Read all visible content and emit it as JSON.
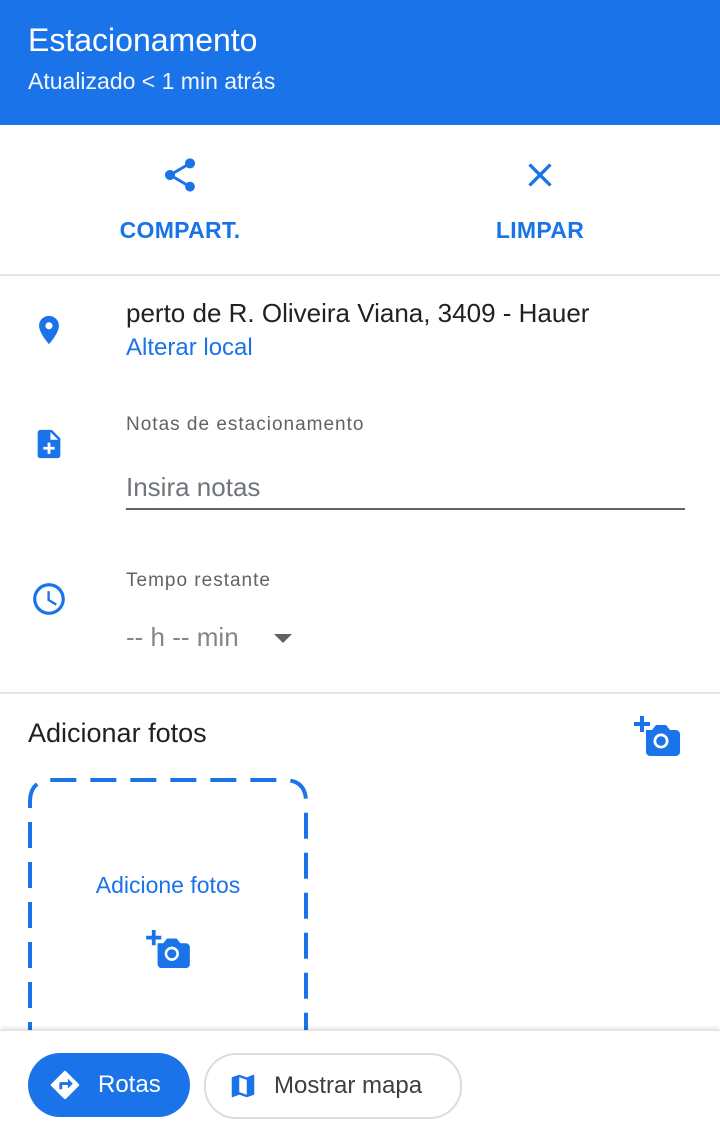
{
  "header": {
    "title": "Estacionamento",
    "subtitle": "Atualizado < 1 min atrás"
  },
  "actions": {
    "share_label": "COMPART.",
    "clear_label": "LIMPAR"
  },
  "location": {
    "address": "perto de R. Oliveira Viana, 3409 - Hauer",
    "change_link": "Alterar local"
  },
  "notes": {
    "label": "Notas de estacionamento",
    "placeholder": "Insira notas",
    "value": ""
  },
  "time": {
    "label": "Tempo restante",
    "value": "-- h -- min"
  },
  "photos": {
    "title": "Adicionar fotos",
    "box_label": "Adicione fotos"
  },
  "bottom_bar": {
    "routes_label": "Rotas",
    "map_label": "Mostrar mapa"
  },
  "colors": {
    "accent": "#1a73e8",
    "header_bg": "#1a73e8",
    "text_primary": "#202124",
    "text_secondary": "#5f6368",
    "divider": "#e6e6e6"
  },
  "icons": {
    "share": "share-icon",
    "clear": "close-icon",
    "location": "location-pin-icon",
    "notes": "note-add-icon",
    "time": "clock-icon",
    "time_dropdown": "dropdown-caret-icon",
    "add_photo": "add-photo-camera-icon",
    "routes": "directions-icon",
    "map": "map-icon"
  }
}
